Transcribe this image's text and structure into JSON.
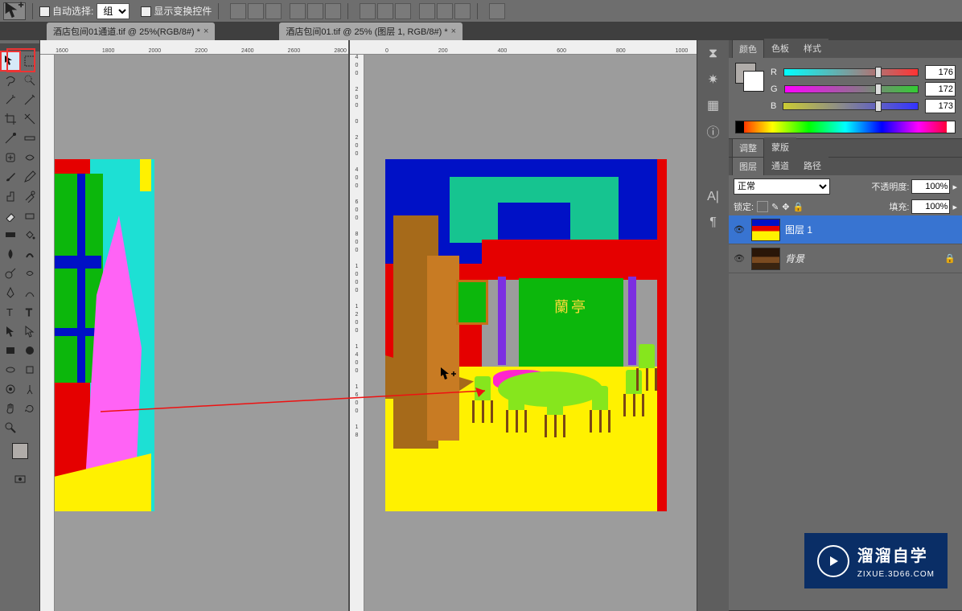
{
  "options_bar": {
    "auto_select_label": "自动选择:",
    "group_select": "组",
    "show_transform_label": "显示变换控件"
  },
  "tabs": {
    "doc1": "酒店包间01通道.tif @ 25%(RGB/8#) *",
    "doc2": "酒店包间01.tif @ 25% (图层 1, RGB/8#) *"
  },
  "rulers": {
    "left_h": [
      "1600",
      "1800",
      "2000",
      "2200",
      "2400",
      "2600",
      "2800"
    ],
    "right_h": [
      "0",
      "200",
      "400",
      "600",
      "800",
      "1000"
    ],
    "left_v": [
      ""
    ],
    "right_v": [
      "4",
      "0",
      "0",
      "",
      "2",
      "0",
      "0",
      "",
      "0",
      "",
      "2",
      "0",
      "0",
      "",
      "4",
      "0",
      "0",
      "",
      "6",
      "0",
      "0",
      "",
      "8",
      "0",
      "0",
      "",
      "1",
      "0",
      "0",
      "0",
      "",
      "1",
      "2",
      "0",
      "0",
      "",
      "1",
      "4",
      "0",
      "0",
      "",
      "1",
      "6",
      "0",
      "0",
      "",
      "1",
      "8"
    ]
  },
  "room": {
    "sign_text": "蘭亭"
  },
  "panels": {
    "color": {
      "tab_color": "颜色",
      "tab_swatches": "色板",
      "tab_styles": "样式",
      "r_label": "R",
      "r_value": "176",
      "g_label": "G",
      "g_value": "172",
      "b_label": "B",
      "b_value": "173"
    },
    "adjust": {
      "tab_adjust": "调整",
      "tab_mask": "蒙版"
    },
    "layers": {
      "tab_layers": "图层",
      "tab_channels": "通道",
      "tab_paths": "路径",
      "blend_mode": "正常",
      "opacity_label": "不透明度:",
      "opacity_value": "100%",
      "lock_label": "锁定:",
      "fill_label": "填充:",
      "fill_value": "100%",
      "items": [
        {
          "name": "图层 1",
          "selected": true,
          "locked": false
        },
        {
          "name": "背景",
          "selected": false,
          "locked": true
        }
      ]
    }
  },
  "watermark": {
    "title": "溜溜自学",
    "sub": "ZIXUE.3D66.COM"
  }
}
